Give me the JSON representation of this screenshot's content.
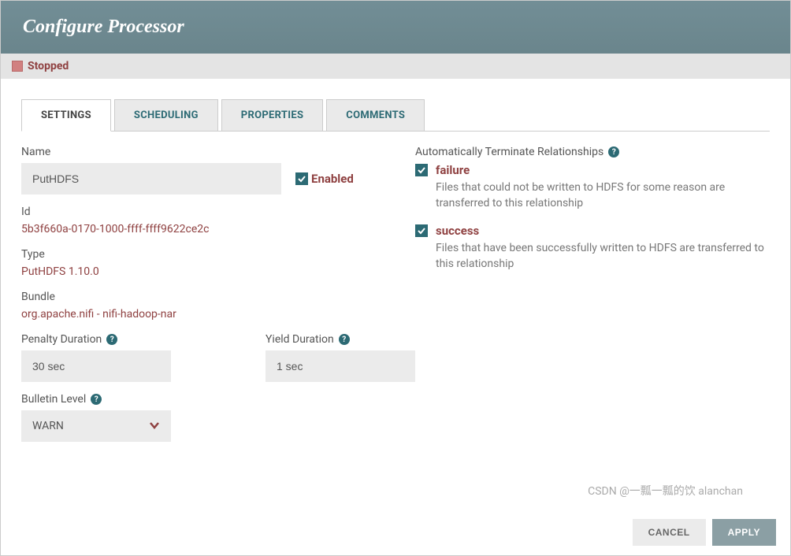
{
  "header": {
    "title": "Configure Processor"
  },
  "status": {
    "label": "Stopped"
  },
  "tabs": {
    "settings": "SETTINGS",
    "scheduling": "SCHEDULING",
    "properties": "PROPERTIES",
    "comments": "COMMENTS"
  },
  "settings": {
    "name_label": "Name",
    "name_value": "PutHDFS",
    "enabled_label": "Enabled",
    "id_label": "Id",
    "id_value": "5b3f660a-0170-1000-ffff-ffff9622ce2c",
    "type_label": "Type",
    "type_value": "PutHDFS 1.10.0",
    "bundle_label": "Bundle",
    "bundle_value": "org.apache.nifi - nifi-hadoop-nar",
    "penalty_label": "Penalty Duration",
    "penalty_value": "30 sec",
    "yield_label": "Yield Duration",
    "yield_value": "1 sec",
    "bulletin_label": "Bulletin Level",
    "bulletin_value": "WARN"
  },
  "relationships": {
    "header": "Automatically Terminate Relationships",
    "items": [
      {
        "name": "failure",
        "description": "Files that could not be written to HDFS for some reason are transferred to this relationship"
      },
      {
        "name": "success",
        "description": "Files that have been successfully written to HDFS are transferred to this relationship"
      }
    ]
  },
  "footer": {
    "cancel": "CANCEL",
    "apply": "APPLY"
  },
  "watermark": "CSDN @一瓢一瓢的饮 alanchan"
}
